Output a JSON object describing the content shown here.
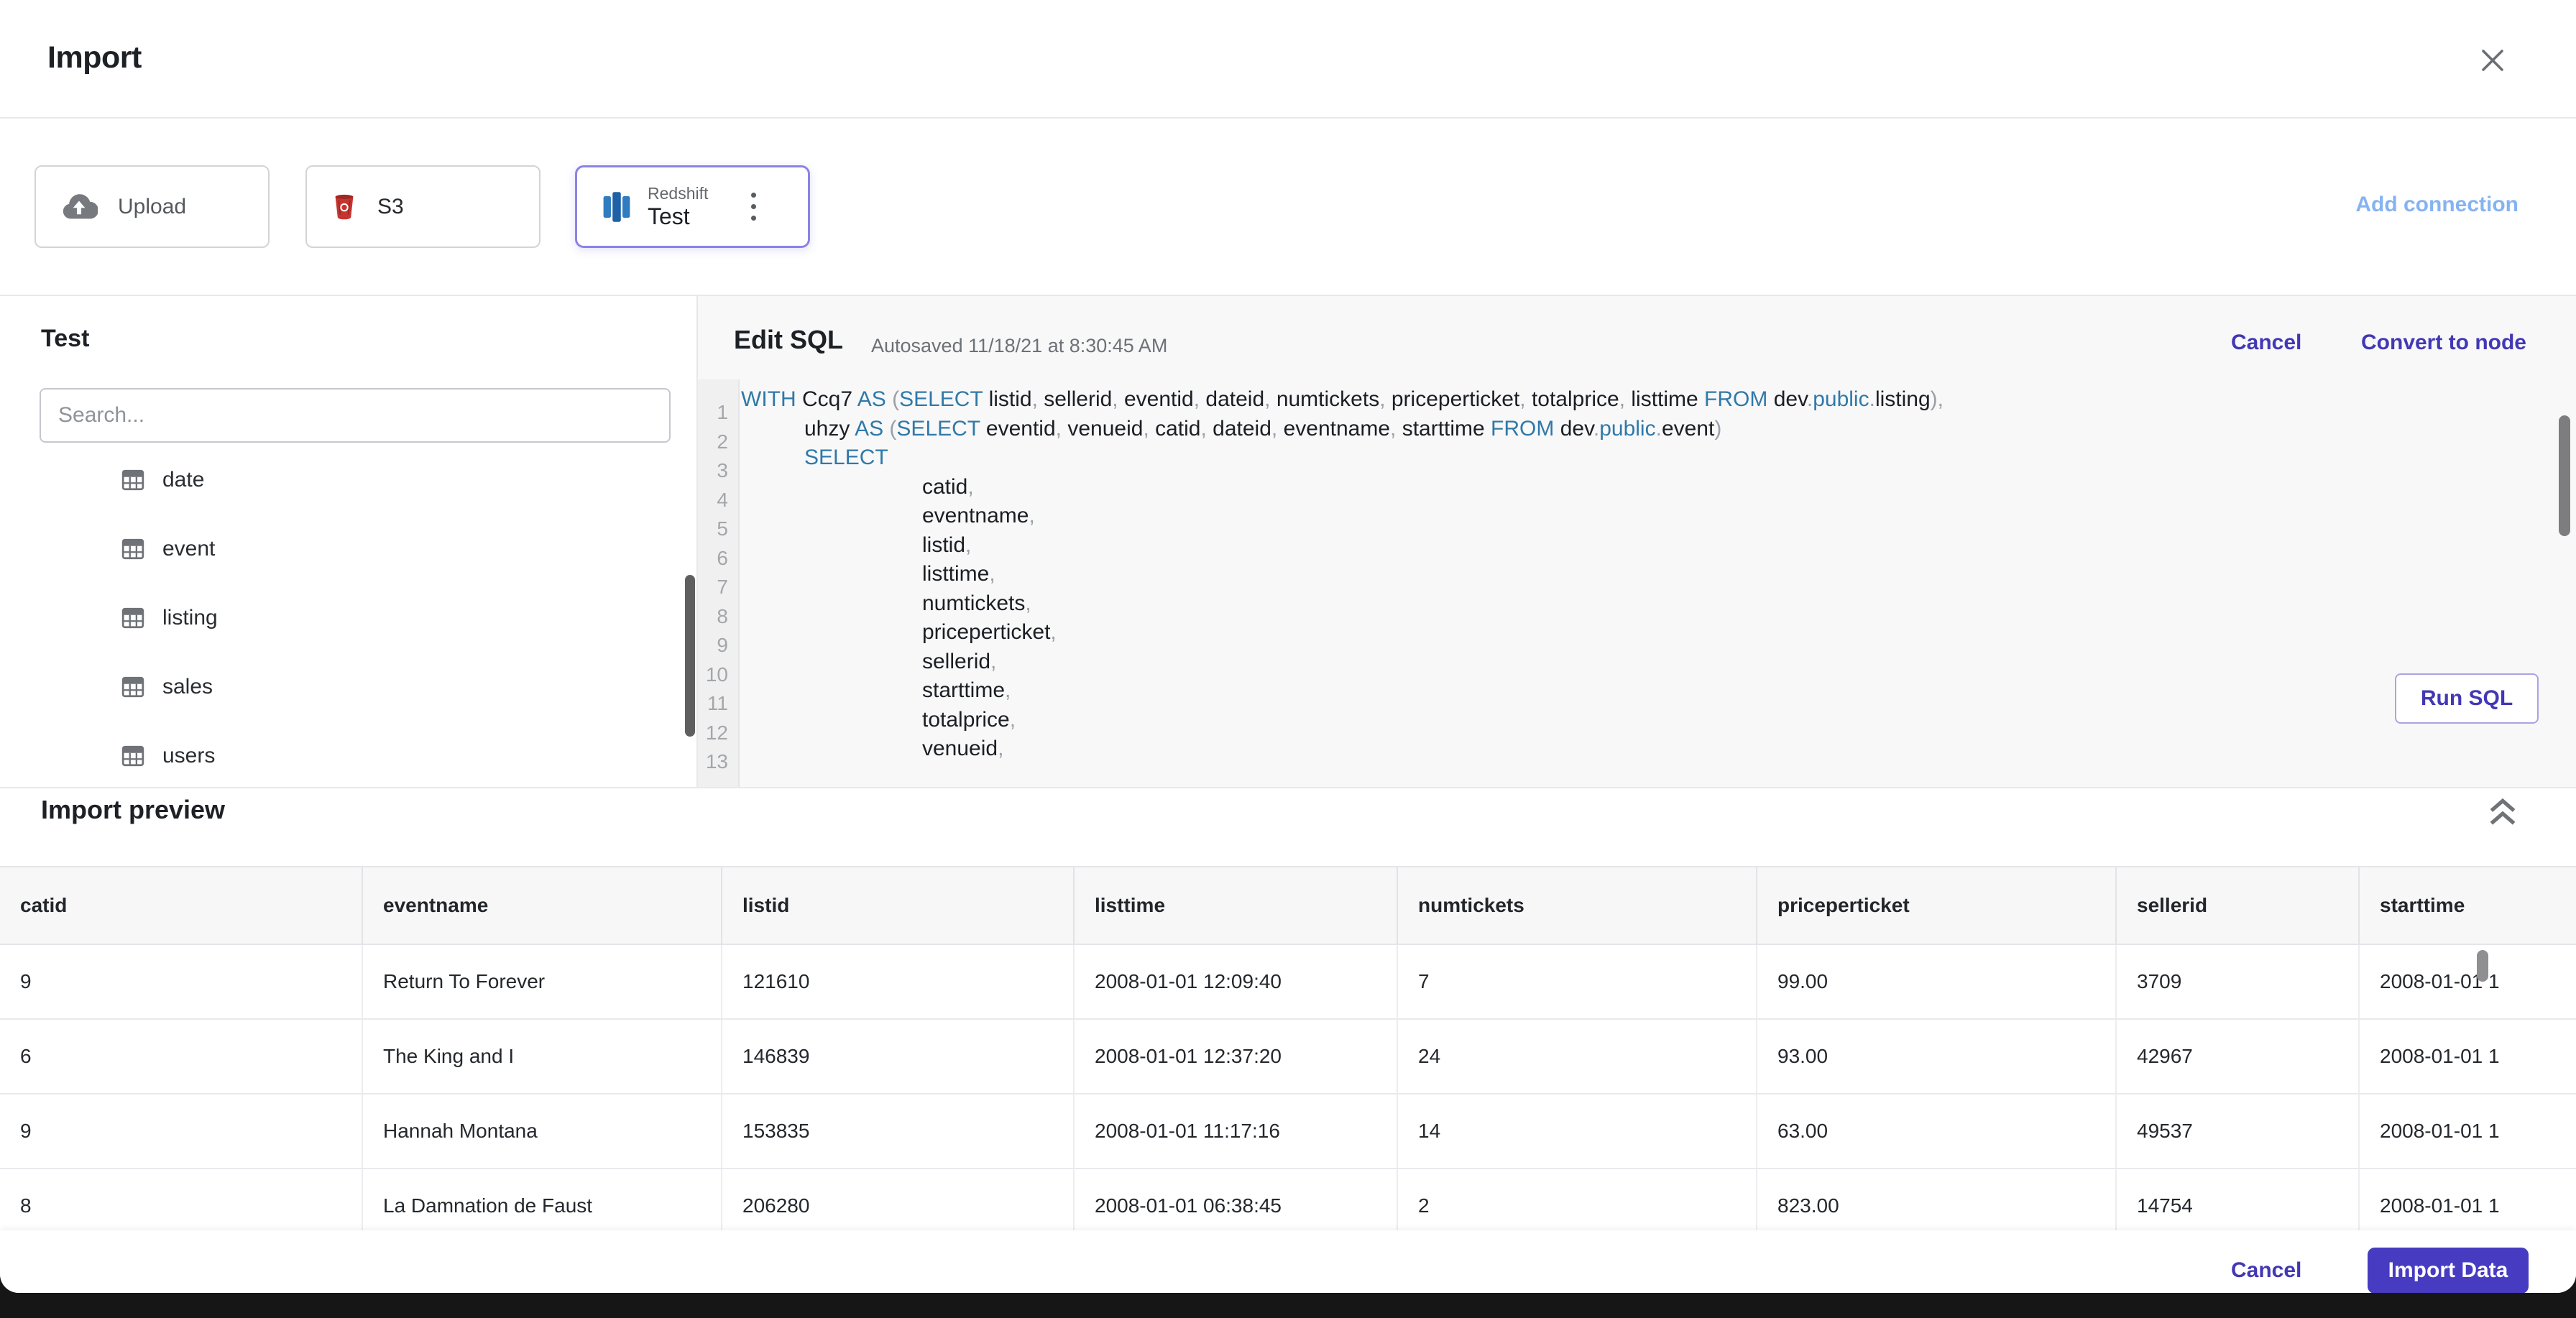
{
  "colors": {
    "accent": "#473bc2",
    "link": "#4238b5",
    "add_link": "#85b3f2",
    "keyword": "#3079a8",
    "code_dim": "#9aa0a6",
    "s3_red": "#c7342f",
    "redshift_blue": "#2f7cc0",
    "selected_border": "#8b83e6"
  },
  "modal": {
    "title": "Import"
  },
  "connections": {
    "add_connection_label": "Add connection",
    "tiles": [
      {
        "id": "upload",
        "label": "Upload",
        "icon": "cloud-upload-icon"
      },
      {
        "id": "s3",
        "label": "S3",
        "icon": "s3-icon"
      },
      {
        "id": "redshift",
        "caption": "Redshift",
        "label": "Test",
        "icon": "redshift-icon",
        "selected": true
      }
    ]
  },
  "left_panel": {
    "title": "Test",
    "search_placeholder": "Search...",
    "tables": [
      {
        "label": "date"
      },
      {
        "label": "event"
      },
      {
        "label": "listing"
      },
      {
        "label": "sales"
      },
      {
        "label": "users"
      }
    ]
  },
  "sql_editor": {
    "title": "Edit SQL",
    "autosaved": "Autosaved 11/18/21 at 8:30:45 AM",
    "cancel_label": "Cancel",
    "convert_label": "Convert to node",
    "run_label": "Run SQL",
    "lines": [
      {
        "n": 1,
        "indent": 0,
        "tokens": [
          [
            "kw",
            "WITH "
          ],
          [
            "id",
            "Ccq7 "
          ],
          [
            "kw",
            "AS "
          ],
          [
            "dim",
            "("
          ],
          [
            "kw",
            "SELECT "
          ],
          [
            "id",
            "listid"
          ],
          [
            "dim",
            ", "
          ],
          [
            "id",
            "sellerid"
          ],
          [
            "dim",
            ", "
          ],
          [
            "id",
            "eventid"
          ],
          [
            "dim",
            ", "
          ],
          [
            "id",
            "dateid"
          ],
          [
            "dim",
            ", "
          ],
          [
            "id",
            "numtickets"
          ],
          [
            "dim",
            ", "
          ],
          [
            "id",
            "priceperticket"
          ],
          [
            "dim",
            ", "
          ],
          [
            "id",
            "totalprice"
          ],
          [
            "dim",
            ", "
          ],
          [
            "id",
            "listtime "
          ],
          [
            "kw",
            "FROM "
          ],
          [
            "id",
            "dev"
          ],
          [
            "dim",
            "."
          ],
          [
            "kw",
            "public"
          ],
          [
            "dim",
            "."
          ],
          [
            "id",
            "listing"
          ],
          [
            "dim",
            "),"
          ]
        ]
      },
      {
        "n": 2,
        "indent": 88,
        "tokens": [
          [
            "id",
            "uhzy "
          ],
          [
            "kw",
            "AS "
          ],
          [
            "dim",
            "("
          ],
          [
            "kw",
            "SELECT "
          ],
          [
            "id",
            "eventid"
          ],
          [
            "dim",
            ", "
          ],
          [
            "id",
            "venueid"
          ],
          [
            "dim",
            ", "
          ],
          [
            "id",
            "catid"
          ],
          [
            "dim",
            ", "
          ],
          [
            "id",
            "dateid"
          ],
          [
            "dim",
            ", "
          ],
          [
            "id",
            "eventname"
          ],
          [
            "dim",
            ", "
          ],
          [
            "id",
            "starttime "
          ],
          [
            "kw",
            "FROM "
          ],
          [
            "id",
            "dev"
          ],
          [
            "dim",
            "."
          ],
          [
            "kw",
            "public"
          ],
          [
            "dim",
            "."
          ],
          [
            "id",
            "event"
          ],
          [
            "dim",
            ")"
          ]
        ]
      },
      {
        "n": 3,
        "indent": 88,
        "tokens": [
          [
            "kw",
            "SELECT"
          ]
        ]
      },
      {
        "n": 4,
        "indent": 252,
        "tokens": [
          [
            "id",
            "catid"
          ],
          [
            "dim",
            ","
          ]
        ]
      },
      {
        "n": 5,
        "indent": 252,
        "tokens": [
          [
            "id",
            "eventname"
          ],
          [
            "dim",
            ","
          ]
        ]
      },
      {
        "n": 6,
        "indent": 252,
        "tokens": [
          [
            "id",
            "listid"
          ],
          [
            "dim",
            ","
          ]
        ]
      },
      {
        "n": 7,
        "indent": 252,
        "tokens": [
          [
            "id",
            "listtime"
          ],
          [
            "dim",
            ","
          ]
        ]
      },
      {
        "n": 8,
        "indent": 252,
        "tokens": [
          [
            "id",
            "numtickets"
          ],
          [
            "dim",
            ","
          ]
        ]
      },
      {
        "n": 9,
        "indent": 252,
        "tokens": [
          [
            "id",
            "priceperticket"
          ],
          [
            "dim",
            ","
          ]
        ]
      },
      {
        "n": 10,
        "indent": 252,
        "tokens": [
          [
            "id",
            "sellerid"
          ],
          [
            "dim",
            ","
          ]
        ]
      },
      {
        "n": 11,
        "indent": 252,
        "tokens": [
          [
            "id",
            "starttime"
          ],
          [
            "dim",
            ","
          ]
        ]
      },
      {
        "n": 12,
        "indent": 252,
        "tokens": [
          [
            "id",
            "totalprice"
          ],
          [
            "dim",
            ","
          ]
        ]
      },
      {
        "n": 13,
        "indent": 252,
        "tokens": [
          [
            "id",
            "venueid"
          ],
          [
            "dim",
            ","
          ]
        ]
      }
    ]
  },
  "preview": {
    "title": "Import preview",
    "columns": [
      "catid",
      "eventname",
      "listid",
      "listtime",
      "numtickets",
      "priceperticket",
      "sellerid",
      "starttime"
    ],
    "rows": [
      [
        "9",
        "Return To Forever",
        "121610",
        "2008-01-01 12:09:40",
        "7",
        "99.00",
        "3709",
        "2008-01-01 1"
      ],
      [
        "6",
        "The King and I",
        "146839",
        "2008-01-01 12:37:20",
        "24",
        "93.00",
        "42967",
        "2008-01-01 1"
      ],
      [
        "9",
        "Hannah Montana",
        "153835",
        "2008-01-01 11:17:16",
        "14",
        "63.00",
        "49537",
        "2008-01-01 1"
      ],
      [
        "8",
        "La Damnation de Faust",
        "206280",
        "2008-01-01 06:38:45",
        "2",
        "823.00",
        "14754",
        "2008-01-01 1"
      ]
    ]
  },
  "footer": {
    "cancel_label": "Cancel",
    "import_label": "Import Data"
  }
}
